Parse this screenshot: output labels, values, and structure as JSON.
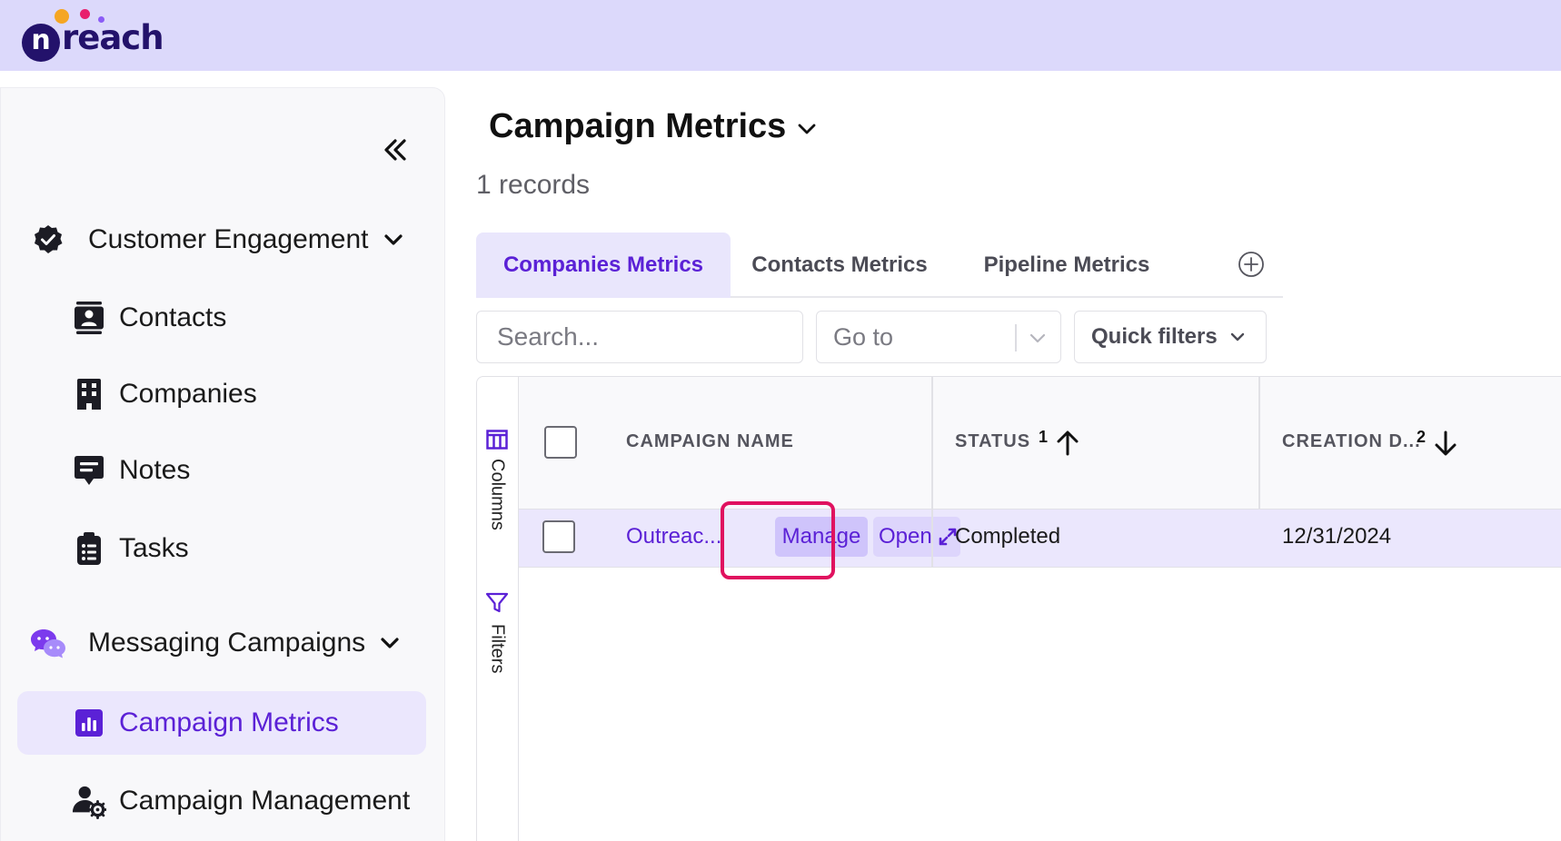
{
  "brand": {
    "name": "reach",
    "mark": "n"
  },
  "sidebar": {
    "collapse_icon": "double-chevron-left-icon",
    "groups": [
      {
        "label": "Customer Engagement",
        "icon": "verified-badge-icon",
        "items": [
          {
            "label": "Contacts",
            "icon": "contact-card-icon"
          },
          {
            "label": "Companies",
            "icon": "building-icon"
          },
          {
            "label": "Notes",
            "icon": "note-bubble-icon"
          },
          {
            "label": "Tasks",
            "icon": "clipboard-icon"
          }
        ]
      },
      {
        "label": "Messaging Campaigns",
        "icon": "chat-bubbles-icon",
        "items": [
          {
            "label": "Campaign Metrics",
            "icon": "bar-chart-icon",
            "active": true
          },
          {
            "label": "Campaign Management",
            "icon": "user-gear-icon"
          }
        ]
      }
    ]
  },
  "main": {
    "title": "Campaign Metrics",
    "record_count": "1 records",
    "tabs": [
      {
        "label": "Companies Metrics",
        "active": true
      },
      {
        "label": "Contacts Metrics"
      },
      {
        "label": "Pipeline Metrics"
      }
    ],
    "search": {
      "placeholder": "Search..."
    },
    "goto": {
      "label": "Go to"
    },
    "quick_filters": {
      "label": "Quick filters"
    }
  },
  "grid": {
    "side_buttons": {
      "columns": "Columns",
      "filters": "Filters"
    },
    "columns": [
      {
        "label": "CAMPAIGN NAME"
      },
      {
        "label": "STATUS",
        "sort_order": "1",
        "sort_dir": "asc"
      },
      {
        "label": "CREATION D...",
        "sort_order": "2",
        "sort_dir": "desc"
      }
    ],
    "rows": [
      {
        "campaign_name": "Outreac...",
        "manage_label": "Manage",
        "open_label": "Open",
        "status": "Completed",
        "creation_date": "12/31/2024"
      }
    ]
  },
  "colors": {
    "topbar": "#dcd9fb",
    "accent": "#5b21d6",
    "active_bg": "#ebe7fd",
    "highlight": "#e0125f"
  }
}
